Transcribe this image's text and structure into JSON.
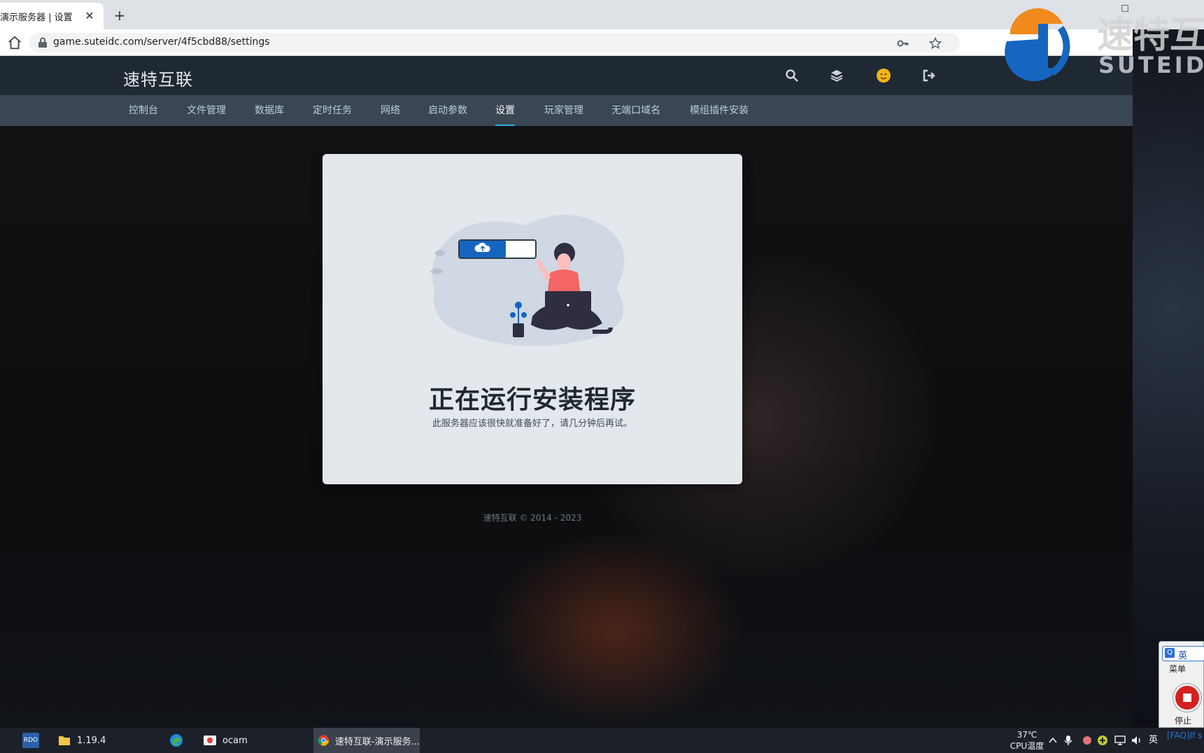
{
  "browser": {
    "tab_title": "演示服务器 | 设置",
    "tab_close": "✕",
    "new_tab": "+",
    "url": "game.suteidc.com/server/4f5cbd88/settings",
    "minimize": "—",
    "maximize": "□",
    "close": "✕"
  },
  "header": {
    "site_title": "速特互联"
  },
  "nav": {
    "items": [
      {
        "label": "控制台"
      },
      {
        "label": "文件管理"
      },
      {
        "label": "数据库"
      },
      {
        "label": "定时任务"
      },
      {
        "label": "网络"
      },
      {
        "label": "启动参数"
      },
      {
        "label": "设置"
      },
      {
        "label": "玩家管理"
      },
      {
        "label": "无端口域名"
      },
      {
        "label": "模组插件安装"
      }
    ],
    "active": "设置"
  },
  "card": {
    "title": "正在运行安装程序",
    "description": "此服务器应该很快就准备好了，请几分钟后再试。"
  },
  "footer": {
    "text": "速特互联 © 2014 - 2023"
  },
  "watermark": {
    "cn": "速特互",
    "en": "SUTEIDC"
  },
  "recorder": {
    "ime_label": "英",
    "menu_label": "菜单",
    "stop_label": "停止",
    "faq_text": "[FAQ]If s"
  },
  "taskbar": {
    "items": [
      {
        "label": "RDO",
        "icon": "rdo-icon"
      },
      {
        "label": "1.19.4",
        "icon": "folder-icon"
      },
      {
        "label": "",
        "icon": "edge-icon"
      },
      {
        "label": "ocam",
        "icon": "ocam-icon"
      },
      {
        "label": "速特互联-演示服务...",
        "icon": "chrome-icon"
      }
    ],
    "temp_value": "37℃",
    "temp_label": "CPU温度",
    "ime_indicator": "英"
  },
  "colors": {
    "header_bg": "#1f2933",
    "nav_bg": "#3a4651",
    "nav_active_underline": "#2bb0ed",
    "card_bg": "#e4e7eb",
    "illustration_blue": "#1565c0"
  }
}
